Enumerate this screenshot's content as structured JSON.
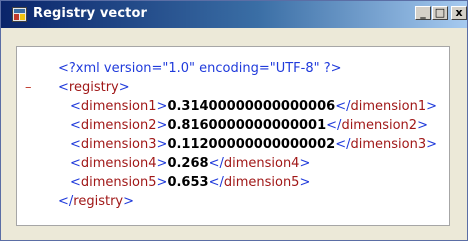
{
  "window": {
    "title": "Registry vector",
    "controls": {
      "minimize": "_",
      "maximize": "□",
      "close": "x"
    }
  },
  "xml": {
    "declaration": "<?xml version=\"1.0\" encoding=\"UTF-8\" ?>",
    "collapse_marker": "–",
    "root_tag": "registry",
    "entries": [
      {
        "tag": "dimension1",
        "value": "0.31400000000000006"
      },
      {
        "tag": "dimension2",
        "value": "0.8160000000000001"
      },
      {
        "tag": "dimension3",
        "value": "0.11200000000000002"
      },
      {
        "tag": "dimension4",
        "value": "0.268"
      },
      {
        "tag": "dimension5",
        "value": "0.653"
      }
    ]
  },
  "colors": {
    "title_gradient_start": "#0a246a",
    "title_gradient_end": "#a6caf0",
    "xml_bracket": "#1f3adb",
    "xml_tag": "#a01818",
    "xml_value": "#000000"
  },
  "icons": {
    "app": "app-window-icon"
  }
}
